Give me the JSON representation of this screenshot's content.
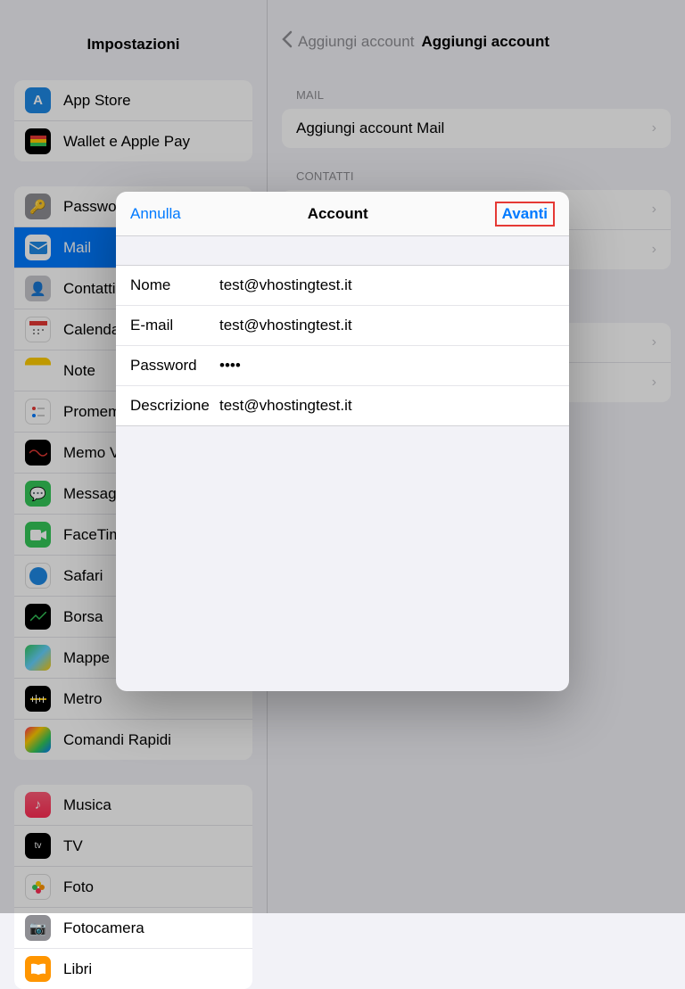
{
  "sidebar": {
    "title": "Impostazioni",
    "group1": [
      {
        "label": "App Store",
        "icon": "A",
        "bg": "#1e88e5"
      },
      {
        "label": "Wallet e Apple Pay",
        "icon": "wallet",
        "bg": "#000"
      }
    ],
    "group2": [
      {
        "label": "Password",
        "icon": "key",
        "bg": "#8e8e93"
      },
      {
        "label": "Mail",
        "icon": "mail",
        "bg": "#1e88e5",
        "selected": true
      },
      {
        "label": "Contatti",
        "icon": "contact",
        "bg": "#8e8e93"
      },
      {
        "label": "Calendario",
        "icon": "cal",
        "bg": "#fff"
      },
      {
        "label": "Note",
        "icon": "note",
        "bg": "#ffcc00"
      },
      {
        "label": "Promemoria",
        "icon": "rem",
        "bg": "#fff"
      },
      {
        "label": "Memo Vocali",
        "icon": "voice",
        "bg": "#000"
      },
      {
        "label": "Messaggi",
        "icon": "msg",
        "bg": "#34c759"
      },
      {
        "label": "FaceTime",
        "icon": "ft",
        "bg": "#34c759"
      },
      {
        "label": "Safari",
        "icon": "safari",
        "bg": "#fff"
      },
      {
        "label": "Borsa",
        "icon": "stocks",
        "bg": "#000"
      },
      {
        "label": "Mappe",
        "icon": "maps",
        "bg": "#64d2ff"
      },
      {
        "label": "Metro",
        "icon": "metro",
        "bg": "#000"
      },
      {
        "label": "Comandi Rapidi",
        "icon": "shortcuts",
        "bg": "#2c2c2e"
      }
    ],
    "group3": [
      {
        "label": "Musica",
        "icon": "music",
        "bg": "#ff2d55"
      },
      {
        "label": "TV",
        "icon": "tv",
        "bg": "#000"
      },
      {
        "label": "Foto",
        "icon": "photo",
        "bg": "#fff"
      },
      {
        "label": "Fotocamera",
        "icon": "cam",
        "bg": "#8e8e93"
      },
      {
        "label": "Libri",
        "icon": "books",
        "bg": "#ff9500"
      }
    ]
  },
  "main": {
    "back": "Aggiungi account",
    "title": "Aggiungi account",
    "sections": [
      {
        "header": "MAIL",
        "rows": [
          {
            "label": "Aggiungi account Mail"
          }
        ]
      },
      {
        "header": "CONTATTI",
        "rows": [
          {
            "label": ""
          },
          {
            "label": ""
          }
        ]
      },
      {
        "header": "",
        "rows": [
          {
            "label": ""
          },
          {
            "label": ""
          }
        ]
      }
    ]
  },
  "modal": {
    "cancel": "Annulla",
    "title": "Account",
    "next": "Avanti",
    "fields": [
      {
        "label": "Nome",
        "value": "test@vhostingtest.it"
      },
      {
        "label": "E-mail",
        "value": "test@vhostingtest.it"
      },
      {
        "label": "Password",
        "value": "••••"
      },
      {
        "label": "Descrizione",
        "value": "test@vhostingtest.it"
      }
    ]
  }
}
